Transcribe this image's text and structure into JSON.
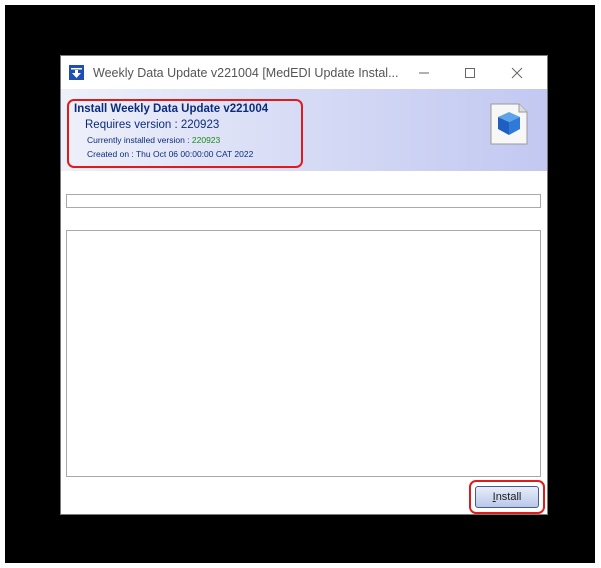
{
  "window": {
    "title": "Weekly Data Update v221004 [MedEDI Update Instal...",
    "icon": "download-arrow-icon"
  },
  "header": {
    "title": "Install Weekly Data Update v221004",
    "requires": "Requires version : 220923",
    "current_label": "Currently installed version : ",
    "current_version": "220923",
    "created": "Created on : Thu Oct 06 00:00:00 CAT 2022",
    "icon": "package-box-icon"
  },
  "progress": {
    "value": 0
  },
  "actions": {
    "install_first": "I",
    "install_rest": "nstall"
  },
  "colors": {
    "header_text": "#0b2c7e",
    "version_green": "#1a8a1a",
    "highlight": "#e01b1b"
  }
}
